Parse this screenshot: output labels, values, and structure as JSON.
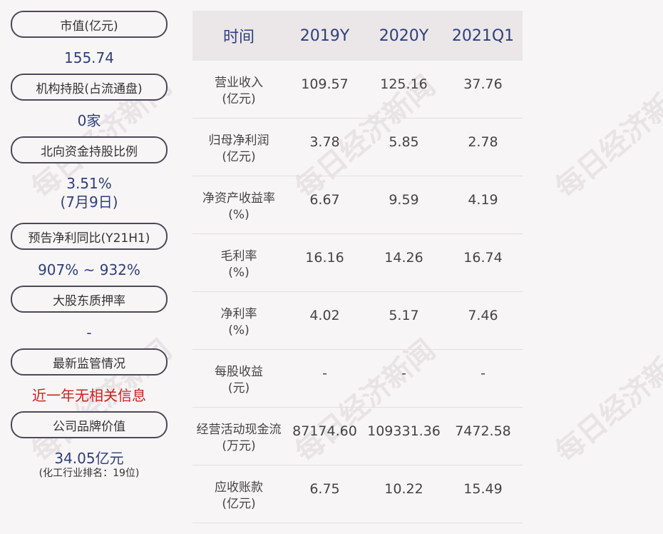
{
  "left": {
    "items": [
      {
        "label": "市值(亿元)",
        "value": "155.74"
      },
      {
        "label": "机构持股(占流通盘)",
        "value": "0家"
      },
      {
        "label": "北向资金持股比例",
        "value": "3.51%",
        "value2": "(7月9日)"
      },
      {
        "label": "预告净利同比(Y21H1)",
        "value": "907% ~ 932%"
      },
      {
        "label": "大股东质押率",
        "value": "-"
      },
      {
        "label": "最新监管情况",
        "value": "近一年无相关信息"
      },
      {
        "label": "公司品牌价值",
        "value": "34.05亿元",
        "sub": "(化工行业排名：19位)"
      }
    ]
  },
  "table": {
    "headers": [
      "时间",
      "2019Y",
      "2020Y",
      "2021Q1"
    ],
    "rows": [
      {
        "label": "营业收入",
        "unit": "(亿元)",
        "values": [
          "109.57",
          "125.16",
          "37.76"
        ]
      },
      {
        "label": "归母净利润",
        "unit": "(亿元)",
        "values": [
          "3.78",
          "5.85",
          "2.78"
        ]
      },
      {
        "label": "净资产收益率",
        "unit": "(%)",
        "values": [
          "6.67",
          "9.59",
          "4.19"
        ]
      },
      {
        "label": "毛利率",
        "unit": "(%)",
        "values": [
          "16.16",
          "14.26",
          "16.74"
        ]
      },
      {
        "label": "净利率",
        "unit": "(%)",
        "values": [
          "4.02",
          "5.17",
          "7.46"
        ]
      },
      {
        "label": "每股收益",
        "unit": "(元)",
        "values": [
          "-",
          "-",
          "-"
        ]
      },
      {
        "label": "经营活动现金流",
        "unit": "(万元)",
        "values": [
          "87174.60",
          "109331.36",
          "7472.58"
        ]
      },
      {
        "label": "应收账款",
        "unit": "(亿元)",
        "values": [
          "6.75",
          "10.22",
          "15.49"
        ]
      }
    ]
  },
  "watermark": "每日经济新闻"
}
